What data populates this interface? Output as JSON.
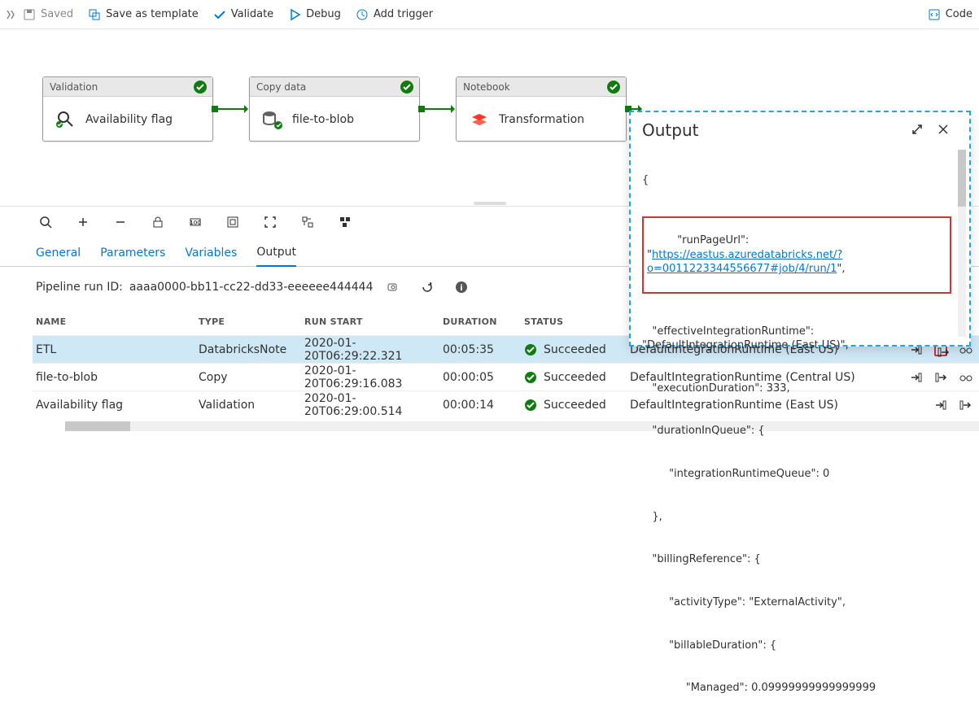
{
  "toolbar": {
    "saved": "Saved",
    "save_as_template": "Save as template",
    "validate": "Validate",
    "debug": "Debug",
    "add_trigger": "Add trigger",
    "code": "Code"
  },
  "activities": [
    {
      "type": "Validation",
      "name": "Availability flag"
    },
    {
      "type": "Copy data",
      "name": "file-to-blob"
    },
    {
      "type": "Notebook",
      "name": "Transformation"
    }
  ],
  "tabs": {
    "general": "General",
    "parameters": "Parameters",
    "variables": "Variables",
    "output": "Output"
  },
  "runid_label": "Pipeline run ID:",
  "runid_value": "aaaa0000-bb11-cc22-dd33-eeeeee444444",
  "columns": {
    "name": "NAME",
    "type": "TYPE",
    "start": "RUN START",
    "duration": "DURATION",
    "status": "STATUS"
  },
  "rows": [
    {
      "name": "ETL",
      "type": "DatabricksNote",
      "start": "2020-01-20T06:29:22.321",
      "duration": "00:05:35",
      "status": "Succeeded",
      "runtime": "DefaultIntegrationRuntime (East US)"
    },
    {
      "name": "file-to-blob",
      "type": "Copy",
      "start": "2020-01-20T06:29:16.083",
      "duration": "00:00:05",
      "status": "Succeeded",
      "runtime": "DefaultIntegrationRuntime (Central US)"
    },
    {
      "name": "Availability flag",
      "type": "Validation",
      "start": "2020-01-20T06:29:00.514",
      "duration": "00:00:14",
      "status": "Succeeded",
      "runtime": "DefaultIntegrationRuntime (East US)"
    }
  ],
  "output": {
    "title": "Output",
    "json_top_brace": "{",
    "runPageUrl_label": "   \"runPageUrl\": \"",
    "runPageUrl_link": "https://eastus.azuredatabricks.net/?o=0011223344556677#job/4/run/1",
    "runPageUrl_close": "\",",
    "line_eir": "   \"effectiveIntegrationRuntime\": \"DefaultIntegrationRuntime (East US)\",",
    "line_exec": "   \"executionDuration\": 333,",
    "line_dq": "   \"durationInQueue\": {",
    "line_irq": "        \"integrationRuntimeQueue\": 0",
    "line_dq_close": "   },",
    "line_br": "   \"billingReference\": {",
    "line_at": "        \"activityType\": \"ExternalActivity\",",
    "line_bd": "        \"billableDuration\": {",
    "line_mgd": "             \"Managed\": 0.09999999999999999"
  }
}
